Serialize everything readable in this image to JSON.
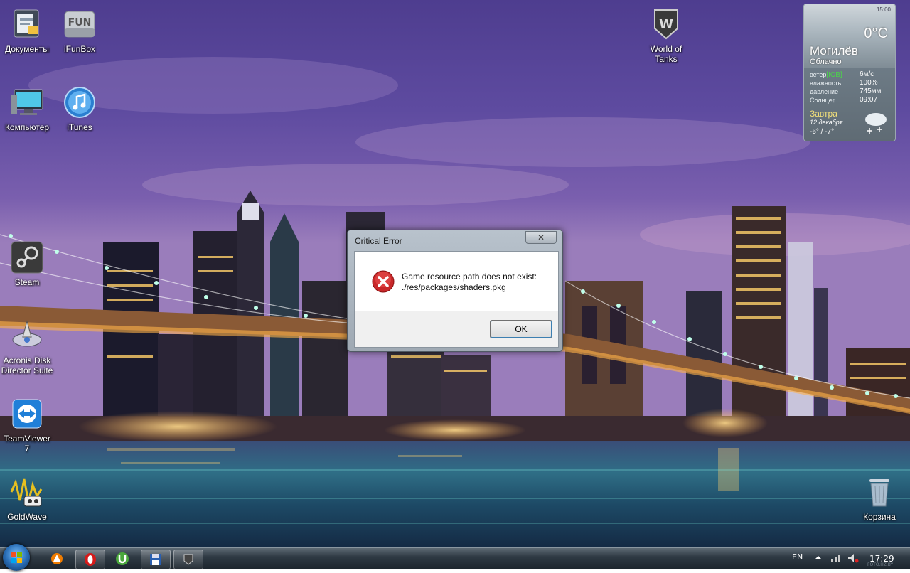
{
  "desktop": {
    "icons": [
      {
        "label": "Документы",
        "icon": "documents-folder-icon"
      },
      {
        "label": "iFunBox",
        "icon": "ifunbox-icon",
        "badge": "FUN"
      },
      {
        "label": "Компьютер",
        "icon": "computer-icon"
      },
      {
        "label": "iTunes",
        "icon": "itunes-icon"
      },
      {
        "label": "Steam",
        "icon": "steam-icon"
      },
      {
        "label_line1": "Acronis Disk",
        "label_line2": "Director Suite",
        "icon": "acronis-icon"
      },
      {
        "label_line1": "TeamViewer",
        "label_line2": "7",
        "icon": "teamviewer-icon"
      },
      {
        "label": "GoldWave",
        "icon": "goldwave-icon"
      },
      {
        "label_line1": "World of",
        "label_line2": "Tanks",
        "icon": "world-of-tanks-icon",
        "badge": "W"
      },
      {
        "label": "Корзина",
        "icon": "recycle-bin-icon"
      }
    ]
  },
  "weather": {
    "time": "15:00",
    "temperature": "0°C",
    "city": "Могилёв",
    "condition": "Облачно",
    "rows": [
      {
        "label_prefix": "ветер",
        "label_highlight": "[ЮВ]",
        "value": "6м/с"
      },
      {
        "label": "влажность",
        "value": "100%"
      },
      {
        "label": "давление",
        "value": "745мм"
      },
      {
        "label": "Солнце↑",
        "value": "09:07"
      }
    ],
    "tomorrow_label": "Завтра",
    "tomorrow_date": "12 декабря",
    "tomorrow_range": "-6° / -7°",
    "highlight_color": "#4cd14c",
    "tomorrow_color": "#f3e07a"
  },
  "dialog": {
    "title": "Critical Error",
    "close_glyph": "✕",
    "message_line1": "Game resource path does not exist:",
    "message_line2": "./res/packages/shaders.pkg",
    "ok_label": "OK",
    "icon": "error-icon"
  },
  "taskbar": {
    "apps": [
      {
        "name": "avast-icon",
        "open": false
      },
      {
        "name": "opera-icon",
        "open": true
      },
      {
        "name": "utorrent-icon",
        "open": false
      },
      {
        "name": "save-floppy-icon",
        "open": true
      },
      {
        "name": "world-of-tanks-taskbar-icon",
        "open": true
      }
    ],
    "language": "EN",
    "clock": "17:29",
    "watermark": "FOTO.HZ.BY"
  }
}
